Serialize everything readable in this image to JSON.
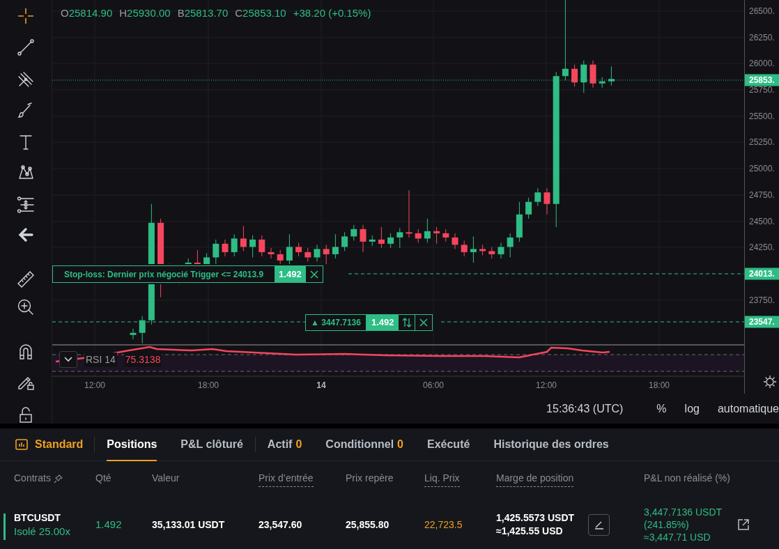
{
  "ohlc": [
    {
      "label": "O",
      "value": "25814.90"
    },
    {
      "label": "H",
      "value": "25930.00"
    },
    {
      "label": "B",
      "value": "25813.70"
    },
    {
      "label": "C",
      "value": "25853.10"
    }
  ],
  "change": "+38.20 (+0.15%)",
  "price_axis": {
    "ticks": [
      "26500.",
      "26250.",
      "26000.",
      "25750.",
      "25500.",
      "25250.",
      "25000.",
      "24750.",
      "24500.",
      "24250.",
      "23750."
    ],
    "tags": [
      {
        "kind": "last",
        "text": "25853."
      },
      {
        "kind": "stop",
        "text": "24013."
      },
      {
        "kind": "entry",
        "text": "23547."
      }
    ]
  },
  "stop_loss_order": {
    "text": "Stop-loss: Dernier prix négocié Trigger <= 24013.9",
    "qty": "1.492"
  },
  "position_line": {
    "pnl": "▲ 3447.7136",
    "qty": "1.492"
  },
  "rsi": {
    "label": "RSI 14",
    "value": "75.3138"
  },
  "time_axis": [
    {
      "label": "12:00",
      "kind": "time"
    },
    {
      "label": "18:00",
      "kind": "time"
    },
    {
      "label": "14",
      "kind": "day"
    },
    {
      "label": "06:00",
      "kind": "time"
    },
    {
      "label": "12:00",
      "kind": "time"
    },
    {
      "label": "18:00",
      "kind": "time"
    }
  ],
  "footer": {
    "clock": "15:36:43 (UTC)",
    "options": [
      "%",
      "log",
      "automatique"
    ]
  },
  "view_mode": {
    "label": "Standard"
  },
  "tabs": [
    {
      "label": "Positions",
      "selected": true
    },
    {
      "label": "P&L clôturé",
      "selected": false
    },
    {
      "label": "Actif",
      "count": "0",
      "selected": false
    },
    {
      "label": "Conditionnel",
      "count": "0",
      "selected": false
    },
    {
      "label": "Exécuté",
      "selected": false
    },
    {
      "label": "Historique des ordres",
      "selected": false
    }
  ],
  "table": {
    "columns": [
      {
        "label": "Contrats",
        "underlined": false
      },
      {
        "label": "Qté",
        "underlined": false
      },
      {
        "label": "Valeur",
        "underlined": false
      },
      {
        "label": "Prix d’entrée",
        "underlined": true
      },
      {
        "label": "Prix repère",
        "underlined": false
      },
      {
        "label": "Liq. Prix",
        "underlined": true
      },
      {
        "label": "Marge de position",
        "underlined": true
      },
      {
        "label": "P&L non réalisé (%)",
        "underlined": false
      }
    ],
    "rows": [
      {
        "contract": "BTCUSDT",
        "mode": "Isolé 25.00x",
        "qty": "1.492",
        "value": "35,133.01 USDT",
        "entry_price": "23,547.60",
        "mark_price": "25,855.80",
        "liq_price": "22,723.5",
        "margin": [
          "1,425.5573 USDT",
          "≈1,425.55 USD"
        ],
        "pnl": [
          "3,447.7136 USDT",
          "(241.85%)",
          "≈3,447.71 USD"
        ]
      }
    ]
  }
}
